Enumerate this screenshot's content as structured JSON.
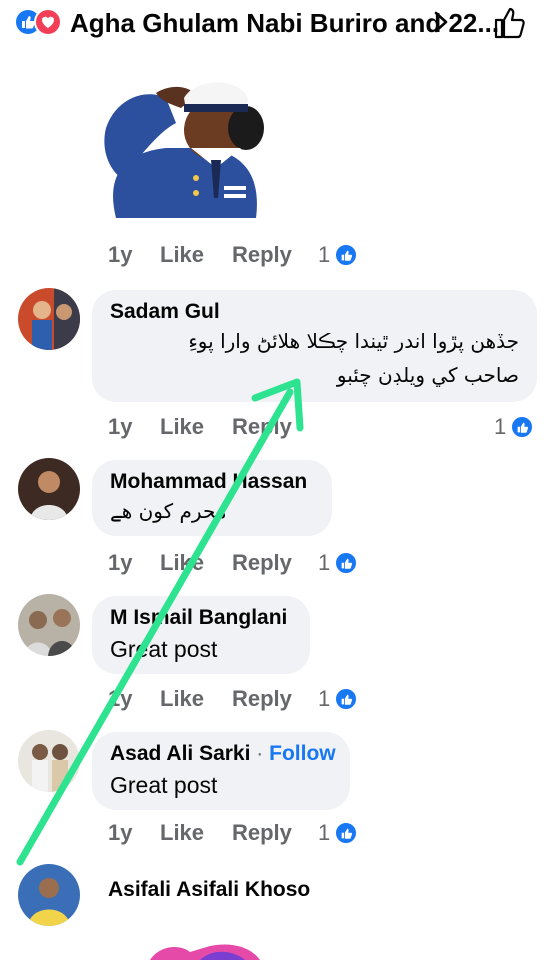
{
  "header": {
    "title": "Agha Ghulam Nabi Buriro and 22...",
    "icons": [
      "like-reaction-icon",
      "love-reaction-icon",
      "chevron-right-icon",
      "thumbs-up-outline-icon"
    ]
  },
  "colors": {
    "accent": "#1877f2",
    "love": "#f33e58",
    "bubble": "#f0f2f5",
    "muted": "#65676b",
    "arrow": "#2ee38f"
  },
  "sticker_actions": {
    "time": "1y",
    "like": "Like",
    "reply": "Reply",
    "count": "1"
  },
  "comments": [
    {
      "name": "Sadam Gul",
      "text_line1": "جڏهن پڙوا اندر ٿيندا چڪلا هلائڻ وارا پوءِ",
      "text_line2": "صاحب کي ويلڊن چئبو",
      "time": "1y",
      "like": "Like",
      "reply": "Reply",
      "count": "1"
    },
    {
      "name": "Mohammad Hassan",
      "text": "محرم کون هے",
      "time": "1y",
      "like": "Like",
      "reply": "Reply",
      "count": "1"
    },
    {
      "name": "M Ismail Banglani",
      "text": "Great post",
      "time": "1y",
      "like": "Like",
      "reply": "Reply",
      "count": "1"
    },
    {
      "name": "Asad Ali Sarki",
      "separator": "·",
      "follow": "Follow",
      "text": "Great post",
      "time": "1y",
      "like": "Like",
      "reply": "Reply",
      "count": "1"
    },
    {
      "name": "Asifali Asifali Khoso"
    }
  ]
}
